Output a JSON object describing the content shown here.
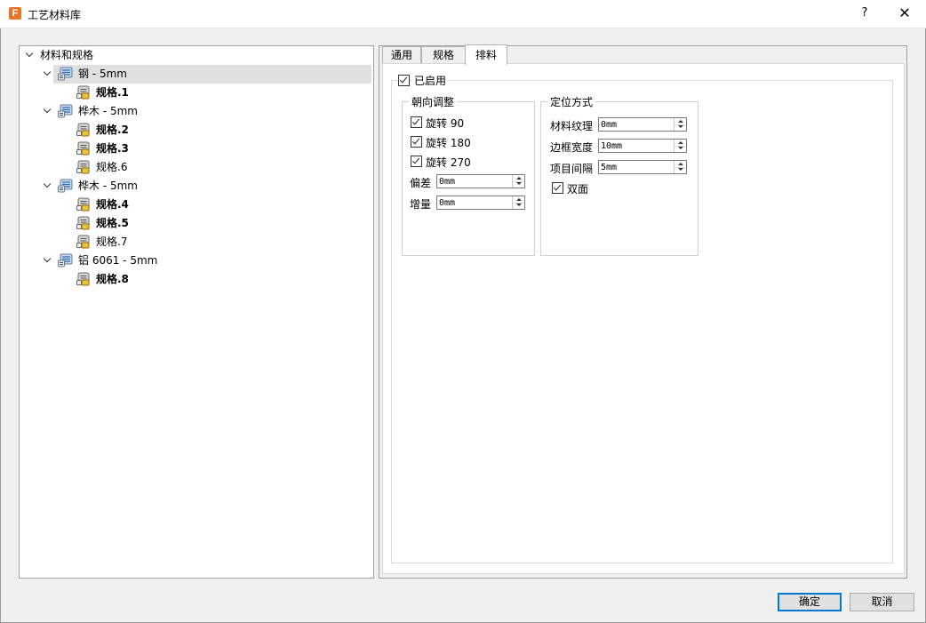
{
  "window": {
    "title": "工艺材料库",
    "app_icon_letter": "F",
    "help_label": "?",
    "close_label": "✕"
  },
  "tree": {
    "root": "材料和规格",
    "materials": [
      {
        "label": "钢 - 5mm",
        "selected": true,
        "specs": [
          {
            "label": "规格.1",
            "bold": true
          }
        ]
      },
      {
        "label": "桦木 - 5mm",
        "selected": false,
        "specs": [
          {
            "label": "规格.2",
            "bold": true
          },
          {
            "label": "规格.3",
            "bold": true
          },
          {
            "label": "规格.6",
            "bold": false
          }
        ]
      },
      {
        "label": "桦木 - 5mm",
        "selected": false,
        "specs": [
          {
            "label": "规格.4",
            "bold": true
          },
          {
            "label": "规格.5",
            "bold": true
          },
          {
            "label": "规格.7",
            "bold": false
          }
        ]
      },
      {
        "label": "铝 6061 - 5mm",
        "selected": false,
        "specs": [
          {
            "label": "规格.8",
            "bold": true
          }
        ]
      }
    ]
  },
  "tabs": [
    {
      "label": "通用",
      "active": false
    },
    {
      "label": "规格",
      "active": false
    },
    {
      "label": "排料",
      "active": true
    }
  ],
  "nesting": {
    "enabled_label": "已启用",
    "orientation": {
      "title": "朝向调整",
      "rotate_90": "旋转 90",
      "rotate_180": "旋转 180",
      "rotate_270": "旋转 270",
      "deviation_label": "偏差",
      "deviation_value": "0mm",
      "increment_label": "增量",
      "increment_value": "0mm"
    },
    "positioning": {
      "title": "定位方式",
      "grain_label": "材料纹理",
      "grain_value": "0mm",
      "border_label": "边框宽度",
      "border_value": "10mm",
      "spacing_label": "项目间隔",
      "spacing_value": "5mm",
      "double_sided": "双面"
    }
  },
  "buttons": {
    "ok": "确定",
    "cancel": "取消"
  },
  "colors": {
    "accent": "#0078d7",
    "icon_orange": "#e8742a",
    "selection": "#e0e0e0"
  }
}
